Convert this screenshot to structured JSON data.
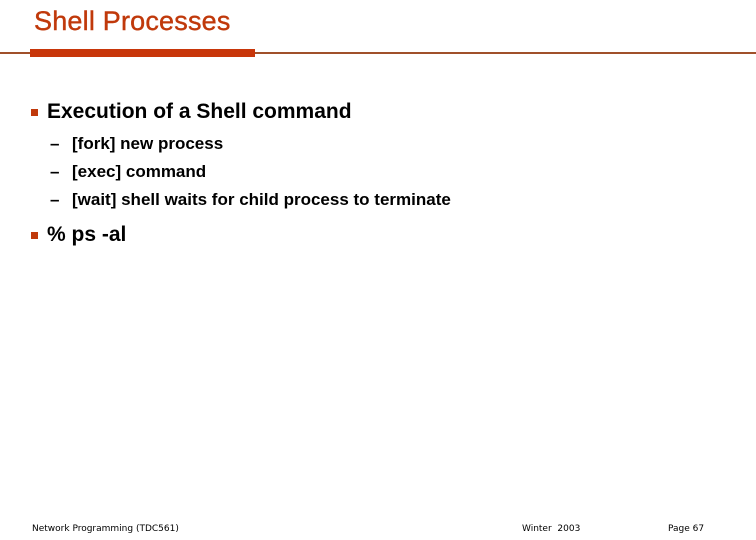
{
  "slide": {
    "title": "Shell Processes",
    "accent_color": "#c0390b",
    "bullets": [
      {
        "text": "Execution of a Shell command",
        "icon": "square-bullet-icon",
        "sub_items": [
          {
            "dash": "–",
            "text": "[fork] new process"
          },
          {
            "dash": "–",
            "text": "[exec] command"
          },
          {
            "dash": "–",
            "text": "[wait] shell waits for child process to terminate"
          }
        ]
      },
      {
        "text": "% ps -al",
        "icon": "square-bullet-icon",
        "sub_items": []
      }
    ],
    "footer": {
      "course": "Network Programming (TDC561)",
      "term": "Winter  2003",
      "page": "Page 67"
    }
  }
}
